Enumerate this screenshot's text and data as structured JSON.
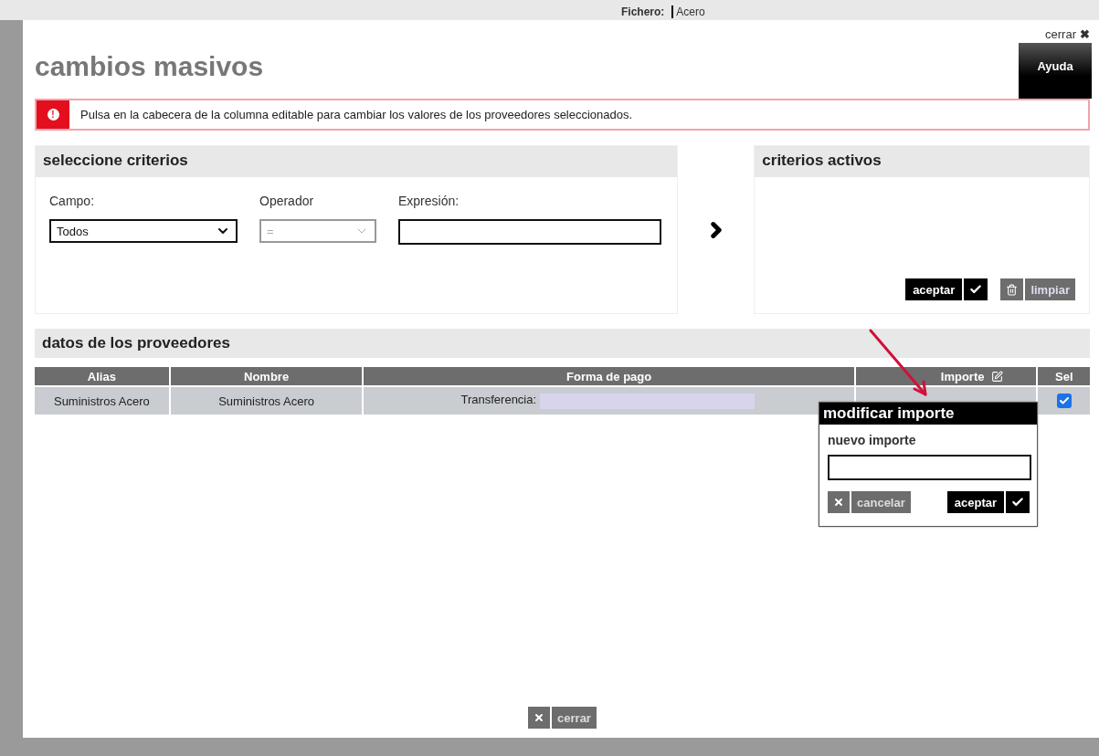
{
  "background": {
    "label": "Fichero:",
    "value": "Acero"
  },
  "dialog": {
    "close_link": "cerrar",
    "close_icon": "✖",
    "title": "cambios masivos",
    "help_button": "Ayuda",
    "alert": {
      "icon": "!",
      "message": "Pulsa en la cabecera de la columna editable para cambiar los valores de los proveedores seleccionados."
    },
    "criteria_panel": {
      "title": "seleccione criterios",
      "fields": [
        {
          "kind": "select",
          "label": "Campo:",
          "value": "Todos",
          "disabled": false
        },
        {
          "kind": "select",
          "label": "Operador",
          "value": "=",
          "disabled": true
        },
        {
          "kind": "text",
          "label": "Expresión:"
        }
      ]
    },
    "active_panel": {
      "title": "criterios activos",
      "buttons": [
        {
          "kind": "accept",
          "label": "aceptar"
        },
        {
          "kind": "clear",
          "label": "limpiar"
        }
      ]
    },
    "suppliers": {
      "title": "datos de los proveedores",
      "columns": [
        {
          "label": "Alias",
          "editable": false
        },
        {
          "label": "Nombre",
          "editable": false
        },
        {
          "label": "Forma de pago",
          "editable": false
        },
        {
          "label": "Importe",
          "editable": true
        },
        {
          "label": "Sel",
          "editable": false
        }
      ],
      "rows": [
        {
          "alias": "Suministros Acero",
          "nombre": "Suministros Acero",
          "forma_de_pago": "Transferencia:",
          "selected": true
        }
      ]
    },
    "edit_popup": {
      "title": "modificar importe",
      "field_label": "nuevo importe",
      "buttons": [
        {
          "kind": "cancel",
          "label": "cancelar"
        },
        {
          "kind": "accept",
          "label": "aceptar"
        }
      ]
    },
    "footer_button": "cerrar"
  }
}
